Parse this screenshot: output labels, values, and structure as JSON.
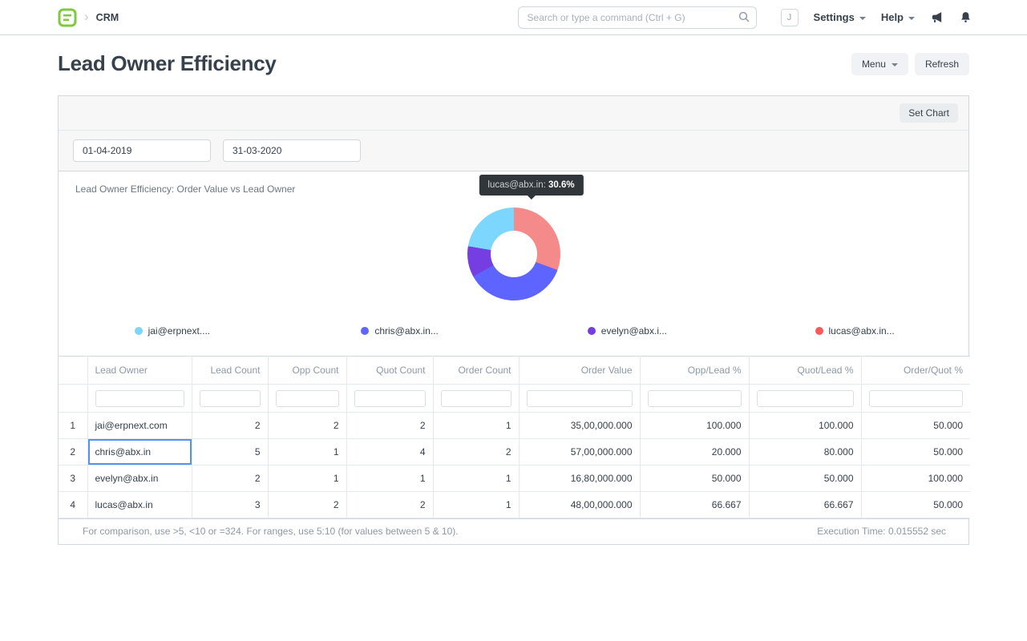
{
  "navbar": {
    "breadcrumb": "CRM",
    "search_placeholder": "Search or type a command (Ctrl + G)",
    "avatar_initial": "J",
    "settings_label": "Settings",
    "help_label": "Help"
  },
  "icons": {
    "logo": "erpnext-logo",
    "breadcrumb_chevron": "›",
    "search": "magnifier",
    "announcement": "megaphone",
    "notifications": "bell",
    "dropdown_caret": "▾"
  },
  "colors": {
    "brand_green": "#7fc93f",
    "focus_blue": "#5292f7",
    "border": "#d1d8dd",
    "muted_text": "#8d99a6"
  },
  "page": {
    "title": "Lead Owner Efficiency",
    "menu_button": "Menu",
    "refresh_button": "Refresh",
    "set_chart_button": "Set Chart"
  },
  "filters": {
    "from_date": "01-04-2019",
    "to_date": "31-03-2020"
  },
  "chart": {
    "title": "Lead Owner Efficiency: Order Value vs Lead Owner",
    "tooltip": {
      "label": "lucas@abx.in:",
      "value": "30.6%"
    },
    "chart_data": {
      "type": "pie",
      "title": "Lead Owner Efficiency: Order Value vs Lead Owner",
      "labels": [
        "jai@erpnext.com",
        "chris@abx.in",
        "evelyn@abx.in",
        "lucas@abx.in"
      ],
      "values": [
        3500000,
        5700000,
        1680000,
        4800000
      ],
      "percentages": [
        22.3,
        36.4,
        10.7,
        30.6
      ],
      "colors": [
        "#7cd6fd",
        "#5e64ff",
        "#743ee2",
        "#ff5858"
      ],
      "legend_labels": [
        "jai@erpnext....",
        "chris@abx.in...",
        "evelyn@abx.i...",
        "lucas@abx.in..."
      ],
      "legend_position": "bottom",
      "donut": true,
      "draw_order": [
        {
          "label": "lucas@abx.in",
          "pct": 30.6,
          "color": "#f48a8a"
        },
        {
          "label": "chris@abx.in",
          "pct": 36.4,
          "color": "#5e64ff"
        },
        {
          "label": "evelyn@abx.in",
          "pct": 10.7,
          "color": "#743ee2"
        },
        {
          "label": "jai@erpnext.com",
          "pct": 22.3,
          "color": "#7cd6fd"
        }
      ]
    }
  },
  "table": {
    "columns": [
      "Lead Owner",
      "Lead Count",
      "Opp Count",
      "Quot Count",
      "Order Count",
      "Order Value",
      "Opp/Lead %",
      "Quot/Lead %",
      "Order/Quot %"
    ],
    "rows": [
      {
        "idx": "1",
        "owner": "jai@erpnext.com",
        "lead": "2",
        "opp": "2",
        "quot": "2",
        "order": "1",
        "value": "35,00,000.000",
        "opp_pct": "100.000",
        "quot_pct": "100.000",
        "order_pct": "50.000"
      },
      {
        "idx": "2",
        "owner": "chris@abx.in",
        "lead": "5",
        "opp": "1",
        "quot": "4",
        "order": "2",
        "value": "57,00,000.000",
        "opp_pct": "20.000",
        "quot_pct": "80.000",
        "order_pct": "50.000"
      },
      {
        "idx": "3",
        "owner": "evelyn@abx.in",
        "lead": "2",
        "opp": "1",
        "quot": "1",
        "order": "1",
        "value": "16,80,000.000",
        "opp_pct": "50.000",
        "quot_pct": "50.000",
        "order_pct": "100.000"
      },
      {
        "idx": "4",
        "owner": "lucas@abx.in",
        "lead": "3",
        "opp": "2",
        "quot": "2",
        "order": "1",
        "value": "48,00,000.000",
        "opp_pct": "66.667",
        "quot_pct": "66.667",
        "order_pct": "50.000"
      }
    ],
    "hint": "For comparison, use >5, <10 or =324. For ranges, use 5:10 (for values between 5 & 10).",
    "execution_time": "Execution Time: 0.015552 sec"
  }
}
